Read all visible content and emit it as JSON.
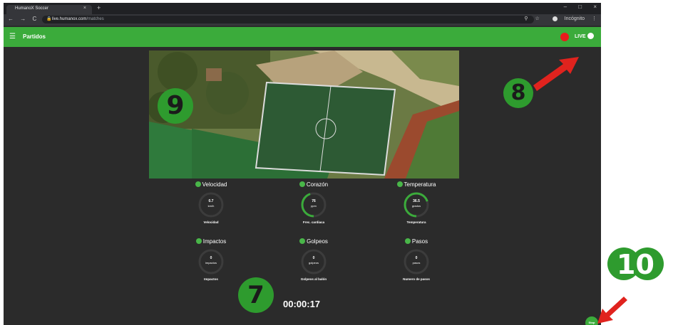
{
  "browser": {
    "tab_title": "HumanoX Soccer",
    "tab_close": "×",
    "new_tab": "+",
    "window_controls": [
      "–",
      "□",
      "×"
    ],
    "nav": {
      "back": "←",
      "forward": "→",
      "reload": "C"
    },
    "url_host": "live.humanox.com",
    "url_path": "/matches",
    "profile_label": "Incógnito"
  },
  "appbar": {
    "title": "Partidos",
    "live_label": "LIVE",
    "accent": "#3bab3b",
    "rec_color": "#e81c1c"
  },
  "metrics": [
    {
      "title": "Velocidad",
      "value": "0.7",
      "unit": "km/h",
      "caption": "Velocidad",
      "icon": "speedometer-icon",
      "level": 0.0
    },
    {
      "title": "Corazón",
      "value": "76",
      "unit": "ppm",
      "caption": "Frec. cardiaca",
      "icon": "heart-icon",
      "level": 0.45
    },
    {
      "title": "Temperatura",
      "value": "36.5",
      "unit": "grados",
      "caption": "Temperatura",
      "icon": "thermometer-icon",
      "level": 0.7
    },
    {
      "title": "Impactos",
      "value": "0",
      "unit": "impactos",
      "caption": "Impactos",
      "icon": "people-icon",
      "level": 0.0
    },
    {
      "title": "Golpeos",
      "value": "0",
      "unit": "golpeos",
      "caption": "Golpeos al balón",
      "icon": "ball-icon",
      "level": 0.0
    },
    {
      "title": "Pasos",
      "value": "0",
      "unit": "pasos",
      "caption": "Numero de pasos",
      "icon": "shoe-icon",
      "level": 0.0
    }
  ],
  "timer": "00:00:17",
  "stop_label": "Stop",
  "callouts": [
    "7",
    "8",
    "9",
    "10"
  ],
  "colors": {
    "callout": "#2e9b2e",
    "arrow": "#e0231e",
    "background": "#2b2b2b"
  }
}
